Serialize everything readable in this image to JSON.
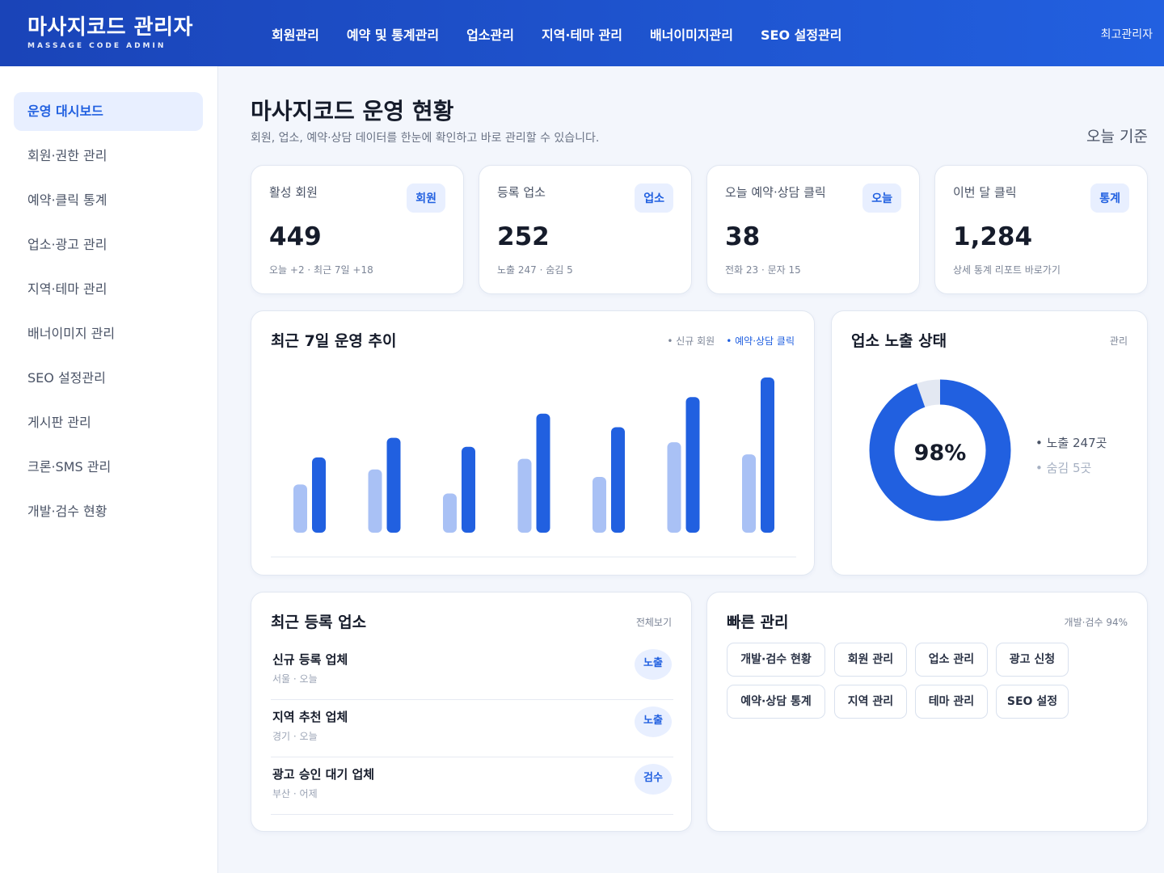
{
  "header": {
    "brand_title": "마사지코드 관리자",
    "brand_sub": "MASSAGE CODE ADMIN",
    "nav": [
      "회원관리",
      "예약 및 통계관리",
      "업소관리",
      "지역·테마 관리",
      "배너이미지관리",
      "SEO 설정관리"
    ],
    "admin": "최고관리자"
  },
  "sidebar": {
    "items": [
      "운영 대시보드",
      "회원·권한 관리",
      "예약·클릭 통계",
      "업소·광고 관리",
      "지역·테마 관리",
      "배너이미지 관리",
      "SEO 설정관리",
      "게시판 관리",
      "크론·SMS 관리",
      "개발·검수 현황"
    ],
    "active_index": 0
  },
  "page": {
    "title": "마사지코드 운영 현황",
    "desc": "회원, 업소, 예약·상담 데이터를 한눈에 확인하고 바로 관리할 수 있습니다.",
    "basis": "오늘 기준"
  },
  "stats": [
    {
      "label": "활성 회원",
      "badge": "회원",
      "value": "449",
      "sub": "오늘 +2 · 최근 7일 +18"
    },
    {
      "label": "등록 업소",
      "badge": "업소",
      "value": "252",
      "sub": "노출 247 · 숨김 5"
    },
    {
      "label": "오늘 예약·상담 클릭",
      "badge": "오늘",
      "value": "38",
      "sub": "전화 23 · 문자 15"
    },
    {
      "label": "이번 달 클릭",
      "badge": "통계",
      "value": "1,284",
      "sub": "상세 통계 리포트 바로가기"
    }
  ],
  "trend": {
    "title": "최근 7일 운영 추이",
    "legend": [
      "• 신규 회원",
      "• 예약·상담 클릭"
    ]
  },
  "exposure": {
    "title": "업소 노출 상태",
    "link": "관리",
    "percent_label": "98%",
    "legend": [
      "• 노출 247곳",
      "• 숨김 5곳"
    ]
  },
  "recent": {
    "title": "최근 등록 업소",
    "link": "전체보기",
    "items": [
      {
        "name": "신규 등록 업체",
        "meta": "서울 · 오늘",
        "badge": "노출"
      },
      {
        "name": "지역 추천 업체",
        "meta": "경기 · 오늘",
        "badge": "노출"
      },
      {
        "name": "광고 승인 대기 업체",
        "meta": "부산 · 어제",
        "badge": "검수"
      }
    ]
  },
  "quick": {
    "title": "빠른 관리",
    "link": "개발·검수 94%",
    "buttons": [
      "개발·검수 현황",
      "회원 관리",
      "업소 관리",
      "광고 신청",
      "예약·상담 통계",
      "지역 관리",
      "테마 관리",
      "SEO 설정"
    ]
  },
  "colors": {
    "accent": "#2160e0",
    "accent_light": "#a9c1f5",
    "track": "#e3e8f2"
  },
  "chart_data": [
    {
      "type": "bar",
      "categories": [
        "",
        "",
        "",
        "",
        "",
        "",
        ""
      ],
      "series": [
        {
          "name": "신규 회원",
          "values": [
            32,
            42,
            26,
            49,
            37,
            60,
            52
          ]
        },
        {
          "name": "예약·상담 클릭",
          "values": [
            50,
            63,
            57,
            79,
            70,
            90,
            103
          ]
        }
      ],
      "ylim": [
        0,
        110
      ],
      "grid": false
    },
    {
      "type": "pie",
      "labels": [
        "노출",
        "숨김"
      ],
      "values": [
        247,
        5
      ]
    }
  ]
}
